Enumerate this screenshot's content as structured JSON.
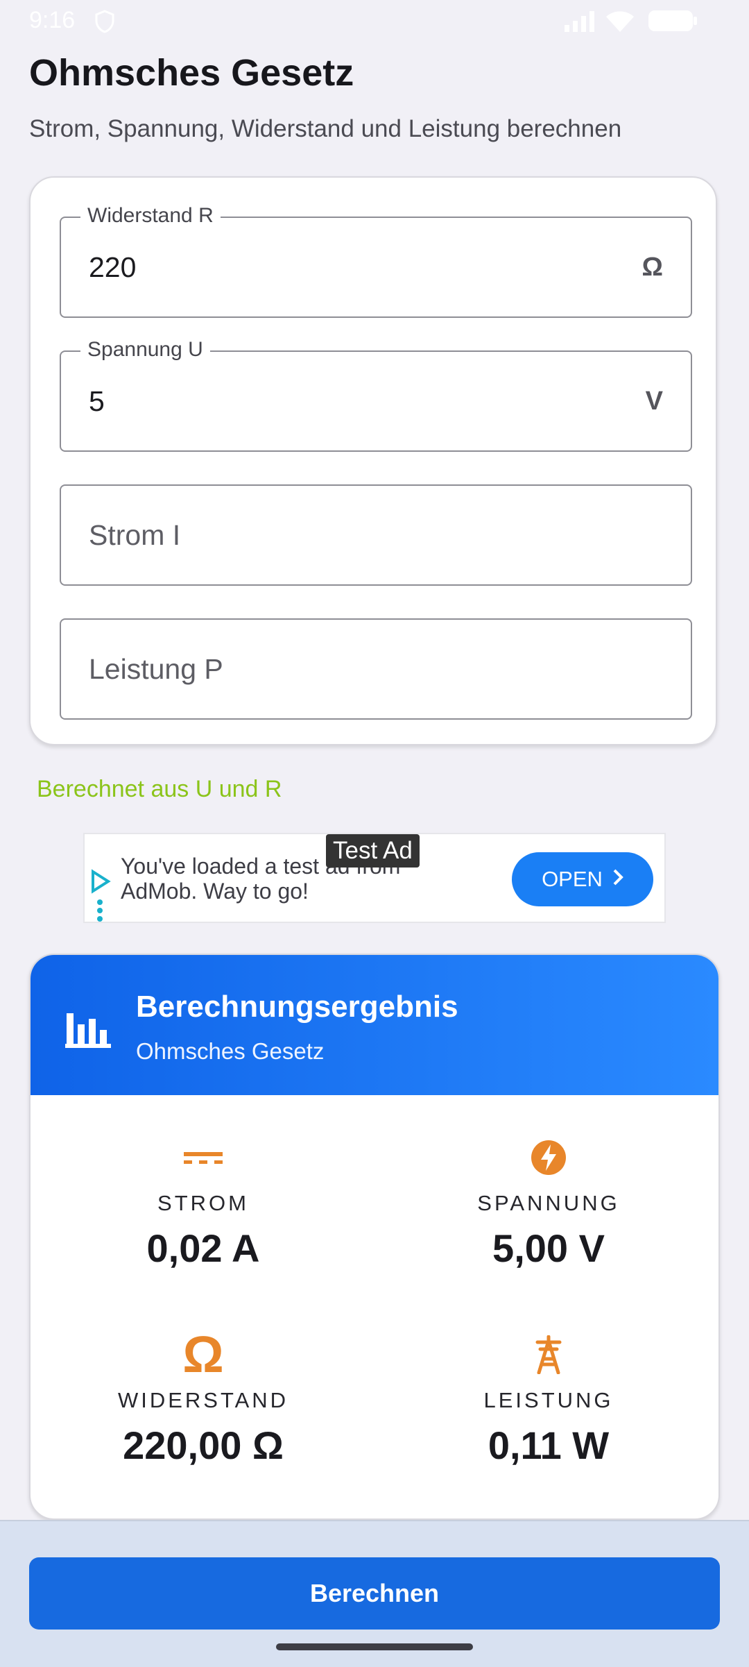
{
  "status_bar": {
    "time": "9:16"
  },
  "header": {
    "title": "Ohmsches Gesetz",
    "subtitle": "Strom, Spannung, Widerstand und Leistung berechnen"
  },
  "inputs": {
    "resistance": {
      "label": "Widerstand R",
      "value": "220",
      "unit": "Ω"
    },
    "voltage": {
      "label": "Spannung U",
      "value": "5",
      "unit": "V"
    },
    "current": {
      "placeholder": "Strom I"
    },
    "power": {
      "placeholder": "Leistung P"
    }
  },
  "hint": {
    "text": "Berechnet aus U und R",
    "color": "#8bc41a"
  },
  "ad": {
    "text": "You've loaded a test ad from AdMob. Way to go!",
    "badge": "Test Ad",
    "button": "OPEN",
    "accent": "#1a7ff5"
  },
  "result": {
    "title": "Berechnungsergebnis",
    "subtitle": "Ohmsches Gesetz",
    "accent": "#0f63e8",
    "metrics": [
      {
        "icon": "dc-current-icon",
        "label": "STROM",
        "value": "0,02 A"
      },
      {
        "icon": "bolt-icon",
        "label": "SPANNUNG",
        "value": "5,00 V"
      },
      {
        "icon": "omega-icon",
        "label": "WIDERSTAND",
        "value": "220,00 Ω"
      },
      {
        "icon": "power-tower-icon",
        "label": "LEISTUNG",
        "value": "0,11 W"
      }
    ],
    "icon_color": "#e8862a"
  },
  "action": {
    "button_label": "Berechnen",
    "color": "#176ae0"
  }
}
